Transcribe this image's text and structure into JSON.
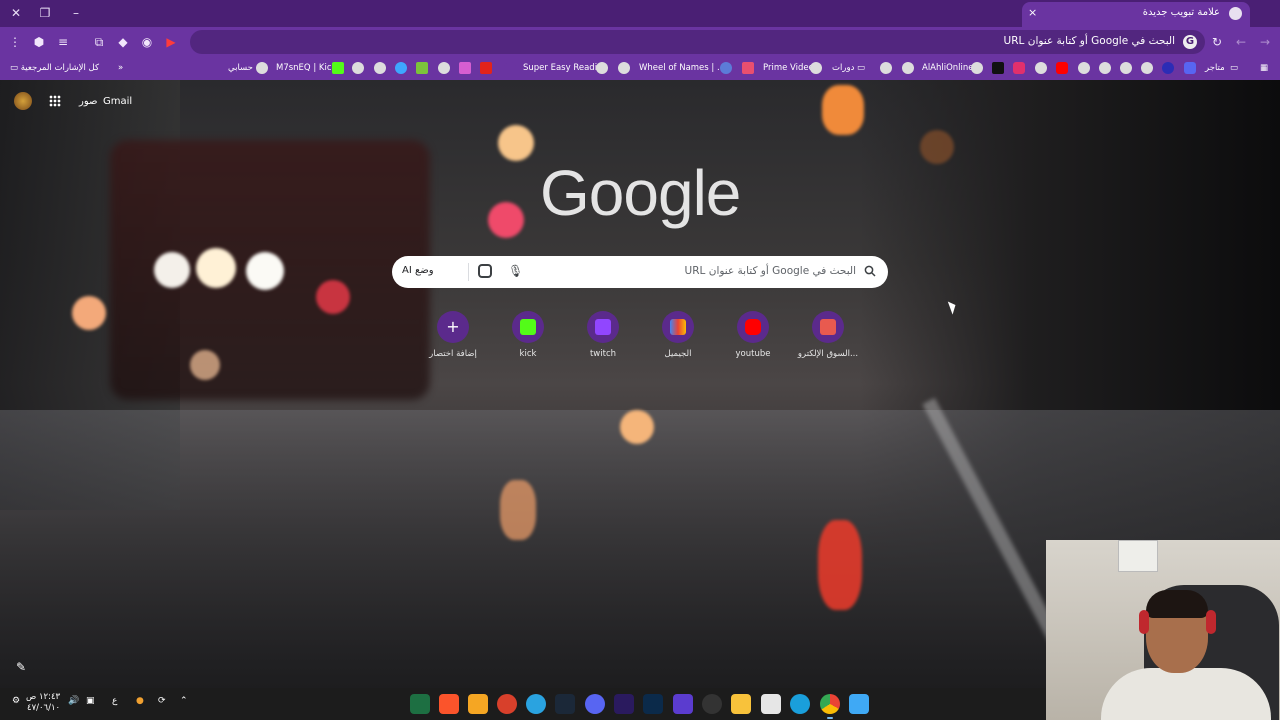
{
  "window": {
    "tab_title": "علامة تبويب جديدة",
    "close_tab": "×",
    "new_tab": "+"
  },
  "toolbar": {
    "omnibox_text": "البحث في Google أو كتابة عنوان URL"
  },
  "bookmarks": {
    "all_bookmarks": "كل الإشارات المرجعية",
    "items": [
      {
        "label": "حسابي"
      },
      {
        "label": "M7snEQ | Kick"
      },
      {
        "label": "Super Easy Reading"
      },
      {
        "label": "Wheel of Names | ..."
      },
      {
        "label": "م..."
      },
      {
        "label": "Prime Video"
      },
      {
        "label": "دورات"
      },
      {
        "label": "AlAhliOnline"
      },
      {
        "label": "متاجر"
      }
    ]
  },
  "ntp": {
    "gmail": "Gmail",
    "images": "صور",
    "logo": "Google",
    "search_placeholder": "البحث في Google أو كتابة عنوان URL",
    "ai_mode": "وضع AI",
    "shortcuts": [
      {
        "label": "إضافة اختصار",
        "color": "#5b2a8c",
        "icon": "plus-icon"
      },
      {
        "label": "kick",
        "color": "#53fc18",
        "icon": "kick-icon"
      },
      {
        "label": "twitch",
        "color": "#9146ff",
        "icon": "twitch-icon"
      },
      {
        "label": "الجيميل",
        "color": "#ea4335",
        "icon": "gmail-icon"
      },
      {
        "label": "youtube",
        "color": "#ff0000",
        "icon": "youtube-icon"
      },
      {
        "label": "السوق الإلكترو...",
        "color": "#e85a4f",
        "icon": "store-icon"
      }
    ]
  },
  "taskbar": {
    "time": "١٢:٤٣ ص",
    "date": "٤٧/٠٦/١٠",
    "lang": "ع"
  },
  "colors": {
    "frame": "#4a1f74",
    "toolbar": "#6a34a1",
    "accent": "#5b2a8c"
  }
}
